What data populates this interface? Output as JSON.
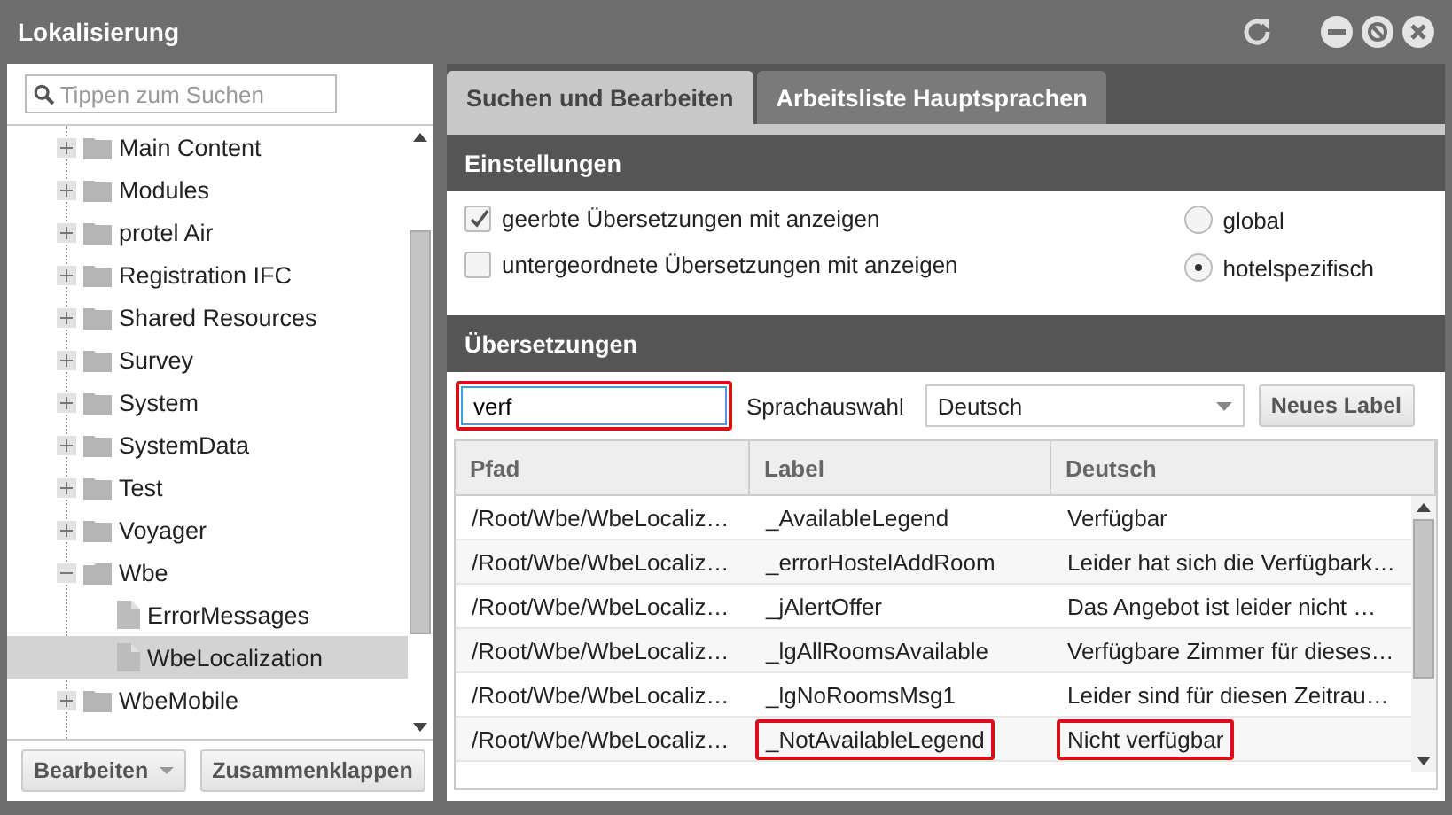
{
  "window": {
    "title": "Lokalisierung"
  },
  "sidebar": {
    "search": {
      "placeholder": "Tippen zum Suchen"
    },
    "tree": [
      {
        "label": "Main Content",
        "kind": "folder",
        "expanded": false,
        "selected": false
      },
      {
        "label": "Modules",
        "kind": "folder",
        "expanded": false,
        "selected": false
      },
      {
        "label": "protel Air",
        "kind": "folder",
        "expanded": false,
        "selected": false
      },
      {
        "label": "Registration IFC",
        "kind": "folder",
        "expanded": false,
        "selected": false
      },
      {
        "label": "Shared Resources",
        "kind": "folder",
        "expanded": false,
        "selected": false
      },
      {
        "label": "Survey",
        "kind": "folder",
        "expanded": false,
        "selected": false
      },
      {
        "label": "System",
        "kind": "folder",
        "expanded": false,
        "selected": false
      },
      {
        "label": "SystemData",
        "kind": "folder",
        "expanded": false,
        "selected": false
      },
      {
        "label": "Test",
        "kind": "folder",
        "expanded": false,
        "selected": false
      },
      {
        "label": "Voyager",
        "kind": "folder",
        "expanded": false,
        "selected": false
      },
      {
        "label": "Wbe",
        "kind": "folder",
        "expanded": true,
        "selected": false,
        "children": [
          {
            "label": "ErrorMessages",
            "kind": "file",
            "selected": false
          },
          {
            "label": "WbeLocalization",
            "kind": "file",
            "selected": true
          }
        ]
      },
      {
        "label": "WbeMobile",
        "kind": "folder",
        "expanded": false,
        "selected": false
      }
    ],
    "buttons": [
      {
        "label": "Bearbeiten",
        "kind": "menu"
      },
      {
        "label": "Zusammenklappen",
        "kind": "plain"
      }
    ]
  },
  "tabs": [
    {
      "label": "Suchen und Bearbeiten",
      "selected": true
    },
    {
      "label": "Arbeitsliste Hauptsprachen",
      "selected": false
    }
  ],
  "settings": {
    "title": "Einstellungen",
    "checkboxes": [
      {
        "label": "geerbte Übersetzungen mit anzeigen",
        "checked": true
      },
      {
        "label": "untergeordnete Übersetzungen mit anzeigen",
        "checked": false
      }
    ],
    "radios": [
      {
        "label": "global",
        "selected": false
      },
      {
        "label": "hotelspezifisch",
        "selected": true
      }
    ]
  },
  "translations": {
    "title": "Übersetzungen",
    "filter": {
      "value": "verf",
      "highlighted": true
    },
    "language_label": "Sprachauswahl",
    "language": "Deutsch",
    "new_button": "Neues Label",
    "columns": [
      "Pfad",
      "Label",
      "Deutsch"
    ],
    "rows": [
      {
        "cells": [
          {
            "text": "/Root/Wbe/WbeLocaliz…",
            "highlighted": false
          },
          {
            "text": "_AvailableLegend",
            "highlighted": false
          },
          {
            "text": "Verfügbar",
            "highlighted": false
          }
        ]
      },
      {
        "cells": [
          {
            "text": "/Root/Wbe/WbeLocaliz…",
            "highlighted": false
          },
          {
            "text": "_errorHostelAddRoom",
            "highlighted": false
          },
          {
            "text": "Leider hat sich die Verfügbark…",
            "highlighted": false
          }
        ]
      },
      {
        "cells": [
          {
            "text": "/Root/Wbe/WbeLocaliz…",
            "highlighted": false
          },
          {
            "text": "_jAlertOffer",
            "highlighted": false
          },
          {
            "text": "Das Angebot ist leider nicht …",
            "highlighted": false
          }
        ]
      },
      {
        "cells": [
          {
            "text": "/Root/Wbe/WbeLocaliz…",
            "highlighted": false
          },
          {
            "text": "_lgAllRoomsAvailable",
            "highlighted": false
          },
          {
            "text": "Verfügbare Zimmer für dieses…",
            "highlighted": false
          }
        ]
      },
      {
        "cells": [
          {
            "text": "/Root/Wbe/WbeLocaliz…",
            "highlighted": false
          },
          {
            "text": "_lgNoRoomsMsg1",
            "highlighted": false
          },
          {
            "text": "Leider sind für diesen Zeitrau…",
            "highlighted": false
          }
        ]
      },
      {
        "cells": [
          {
            "text": "/Root/Wbe/WbeLocaliz…",
            "highlighted": false
          },
          {
            "text": "_NotAvailableLegend",
            "highlighted": true
          },
          {
            "text": "Nicht verfügbar",
            "highlighted": true
          }
        ]
      }
    ]
  }
}
